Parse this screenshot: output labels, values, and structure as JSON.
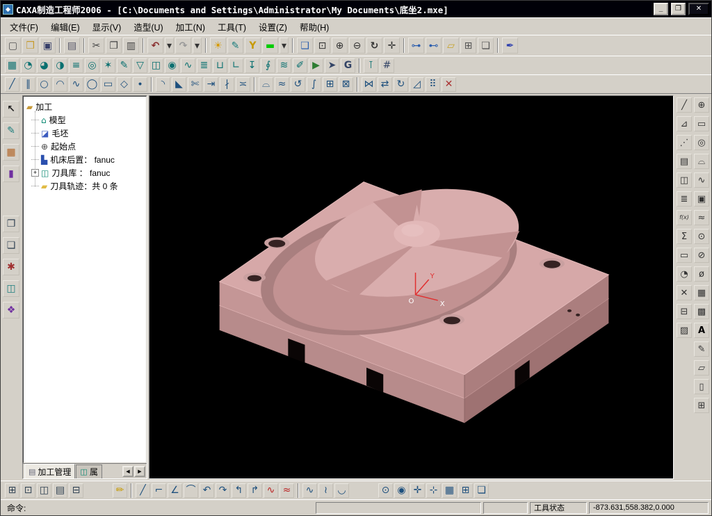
{
  "window": {
    "title": "CAXA制造工程师2006  -  [C:\\Documents and Settings\\Administrator\\My Documents\\底坐2.mxe]",
    "controls": {
      "minimize": "_",
      "restore": "❐",
      "close": "✕"
    }
  },
  "colors": {
    "titlebar": "#000008",
    "canvas-bg": "#000000",
    "model-top": "#d6a8a8",
    "model-side-left": "#c49696",
    "model-side-right": "#ab7e7e",
    "model-base-left": "#b78b8b",
    "model-base-right": "#9e7272",
    "model-rim": "#a97f7f",
    "model-recess": "#c29292",
    "model-boss": "#d9adad",
    "model-boss-light": "#e6bfbf",
    "model-dome": "#e2b8b8",
    "model-hole-rim": "#c9a0a0",
    "model-hole": "#352222",
    "model-notch": "#0a0505",
    "axis-red": "#e03030"
  },
  "menu": {
    "items": [
      {
        "name": "menu-file",
        "label": "文件(F)"
      },
      {
        "name": "menu-edit",
        "label": "编辑(E)"
      },
      {
        "name": "menu-display",
        "label": "显示(V)"
      },
      {
        "name": "menu-modeling",
        "label": "造型(U)"
      },
      {
        "name": "menu-machining",
        "label": "加工(N)"
      },
      {
        "name": "menu-tools",
        "label": "工具(T)"
      },
      {
        "name": "menu-settings",
        "label": "设置(Z)"
      },
      {
        "name": "menu-help",
        "label": "帮助(H)"
      }
    ]
  },
  "toolbar_standard": {
    "items": [
      {
        "name": "new-icon",
        "glyph": "▢",
        "style": "color:#555"
      },
      {
        "name": "open-folder-icon",
        "glyph": "❒",
        "style": "color:#c69b2e"
      },
      {
        "name": "save-icon",
        "glyph": "▣",
        "style": "color:#38406a"
      },
      {
        "cls": "tsep",
        "name": "separator"
      },
      {
        "name": "print-icon",
        "glyph": "▤",
        "style": "color:#556"
      },
      {
        "cls": "tsep",
        "name": "separator"
      },
      {
        "name": "cut-icon",
        "glyph": "✂",
        "style": "color:#444"
      },
      {
        "name": "copy-icon",
        "glyph": "❐",
        "style": "color:#444"
      },
      {
        "name": "paste-icon",
        "glyph": "▥",
        "style": "color:#444"
      },
      {
        "cls": "tsep",
        "name": "separator"
      },
      {
        "name": "undo-icon",
        "glyph": "↶",
        "style": "color:#8a2f2f;font-weight:bold"
      },
      {
        "name": "undo-dropdown-icon",
        "glyph": "▾",
        "cls": "tbtn narrow"
      },
      {
        "name": "redo-icon",
        "glyph": "↷",
        "style": "color:#999;font-weight:bold"
      },
      {
        "name": "redo-dropdown-icon",
        "glyph": "▾",
        "cls": "tbtn narrow"
      },
      {
        "cls": "tsep",
        "name": "separator"
      },
      {
        "name": "light-icon",
        "glyph": "☀",
        "style": "color:#d79a00"
      },
      {
        "name": "shade-mode-icon",
        "glyph": "✎",
        "style": "color:#1b7d7d"
      },
      {
        "name": "filter-icon",
        "glyph": "Y",
        "style": "color:#c79a00;font-weight:bold"
      },
      {
        "name": "color-swatch",
        "glyph": "▬",
        "style": "color:#00cc00"
      },
      {
        "name": "color-dropdown-icon",
        "glyph": "▾",
        "cls": "tbtn narrow"
      },
      {
        "cls": "tsep",
        "name": "separator"
      },
      {
        "name": "viewport-icon",
        "glyph": "❑",
        "style": "color:#2d5fae"
      },
      {
        "name": "zoom-window-icon",
        "glyph": "⊡"
      },
      {
        "name": "zoom-in-icon",
        "glyph": "⊕"
      },
      {
        "name": "zoom-out-icon",
        "glyph": "⊖"
      },
      {
        "name": "refresh-view-icon",
        "glyph": "↻",
        "style": "font-weight:bold"
      },
      {
        "name": "pan-icon",
        "glyph": "✛"
      },
      {
        "cls": "tsep",
        "name": "separator"
      },
      {
        "name": "link-views-icon",
        "glyph": "⊶",
        "style": "color:#2d5fae"
      },
      {
        "name": "unlink-views-icon",
        "glyph": "⊷",
        "style": "color:#2d5fae"
      },
      {
        "name": "measure-icon",
        "glyph": "▱",
        "style": "color:#c7a227"
      },
      {
        "name": "new-window-icon",
        "glyph": "⊞",
        "style": "color:#555"
      },
      {
        "name": "arrange-windows-icon",
        "glyph": "❏",
        "style": "color:#555"
      },
      {
        "cls": "tsep",
        "name": "separator"
      },
      {
        "name": "annotate-icon",
        "glyph": "✒",
        "style": "color:#2d3fae"
      }
    ]
  },
  "toolbar_machining": {
    "items": [
      {
        "name": "stock-define-icon",
        "glyph": "▦"
      },
      {
        "name": "rough-plane-icon",
        "glyph": "◔"
      },
      {
        "name": "rough-region-icon",
        "glyph": "◕"
      },
      {
        "name": "rough-contour-icon",
        "glyph": "◑"
      },
      {
        "name": "finish-parallel-icon",
        "glyph": "≡"
      },
      {
        "name": "finish-contour-icon",
        "glyph": "◎"
      },
      {
        "name": "finish-radial-icon",
        "glyph": "✶"
      },
      {
        "name": "pencil-cut-icon",
        "glyph": "✎"
      },
      {
        "name": "projection-cut-icon",
        "glyph": "▽"
      },
      {
        "name": "region-surface-icon",
        "glyph": "◫"
      },
      {
        "name": "contour-surface-icon",
        "glyph": "◉"
      },
      {
        "name": "guide-curve-icon",
        "glyph": "∿"
      },
      {
        "name": "z-level-icon",
        "glyph": "≣"
      },
      {
        "name": "groove-cut-icon",
        "glyph": "⊔"
      },
      {
        "name": "corner-clean-icon",
        "glyph": "∟"
      },
      {
        "name": "drill-icon",
        "glyph": "↧"
      },
      {
        "name": "thread-cut-icon",
        "glyph": "∮"
      },
      {
        "name": "trajectory-batch-icon",
        "glyph": "≋"
      },
      {
        "name": "trajectory-edit-icon",
        "glyph": "✐"
      },
      {
        "name": "simulate-icon",
        "glyph": "▶",
        "style": "color:#2e7d32"
      },
      {
        "name": "post-process-icon",
        "glyph": "➤",
        "style": "color:#334466"
      },
      {
        "name": "gcode-icon",
        "glyph": "G",
        "style": "color:#334466;font-weight:bold"
      },
      {
        "cls": "tsep",
        "name": "separator"
      },
      {
        "name": "tool-library-icon",
        "glyph": "⊺"
      },
      {
        "name": "machine-setup-icon",
        "glyph": "#",
        "style": "color:#334466"
      }
    ]
  },
  "toolbar_curves": {
    "items": [
      {
        "name": "line-icon",
        "glyph": "╱"
      },
      {
        "name": "parallel-line-icon",
        "glyph": "∥"
      },
      {
        "name": "circle-icon",
        "glyph": "○"
      },
      {
        "name": "arc-icon",
        "glyph": "◠"
      },
      {
        "name": "spline-icon",
        "glyph": "∿"
      },
      {
        "name": "ellipse-icon",
        "glyph": "◯"
      },
      {
        "name": "rectangle-icon",
        "glyph": "▭"
      },
      {
        "name": "polygon-icon",
        "glyph": "◇"
      },
      {
        "name": "point-icon",
        "glyph": "∙"
      },
      {
        "cls": "tsep",
        "name": "separator"
      },
      {
        "name": "fillet-icon",
        "glyph": "◝"
      },
      {
        "name": "chamfer-icon",
        "glyph": "◣"
      },
      {
        "name": "trim-icon",
        "glyph": "✄"
      },
      {
        "name": "extend-icon",
        "glyph": "⇥"
      },
      {
        "name": "break-icon",
        "glyph": "∤"
      },
      {
        "name": "offset-icon",
        "glyph": "≍"
      },
      {
        "cls": "tsep",
        "name": "separator"
      },
      {
        "name": "surface-ruled-icon",
        "glyph": "⌓"
      },
      {
        "name": "surface-loft-icon",
        "glyph": "≈"
      },
      {
        "name": "surface-revolve-icon",
        "glyph": "↺"
      },
      {
        "name": "surface-sweep-icon",
        "glyph": "∫"
      },
      {
        "name": "surface-patch-icon",
        "glyph": "⊞"
      },
      {
        "name": "surface-trim-icon",
        "glyph": "⊠"
      },
      {
        "cls": "tsep",
        "name": "separator"
      },
      {
        "name": "mirror-icon",
        "glyph": "⋈"
      },
      {
        "name": "translate-icon",
        "glyph": "⇄"
      },
      {
        "name": "rotate-icon",
        "glyph": "↻"
      },
      {
        "name": "scale-icon",
        "glyph": "◿"
      },
      {
        "name": "array-icon",
        "glyph": "⠿"
      },
      {
        "name": "delete-icon",
        "glyph": "✕",
        "style": "color:#aa3333"
      }
    ]
  },
  "left_toolbar": {
    "items": [
      {
        "name": "select-cursor-icon",
        "glyph": "↖",
        "style": "font-weight:bold;color:#222"
      },
      {
        "name": "sketch-icon",
        "glyph": "✎",
        "style": "color:#1b7d7d"
      },
      {
        "name": "layer-table-icon",
        "glyph": "▦",
        "style": "color:#b06020"
      },
      {
        "name": "material-icon",
        "glyph": "▮",
        "style": "color:#7030a0"
      },
      {
        "cls": "tgap",
        "name": "gap"
      },
      {
        "name": "copy-feature-icon",
        "glyph": "❐",
        "style": "color:#334455"
      },
      {
        "name": "paste-feature-icon",
        "glyph": "❏",
        "style": "color:#334455"
      },
      {
        "name": "process-sheet-icon",
        "glyph": "✱",
        "style": "color:#a03030"
      },
      {
        "name": "tool-db-icon",
        "glyph": "◫",
        "style": "color:#1b7d7d"
      },
      {
        "name": "palette-icon",
        "glyph": "❖",
        "style": "color:#7030a0"
      }
    ]
  },
  "right_toolbar_outer": {
    "items": [
      {
        "name": "query-line-icon",
        "glyph": "╱"
      },
      {
        "name": "query-angle-icon",
        "glyph": "⊿"
      },
      {
        "name": "query-points-icon",
        "glyph": "⋰"
      },
      {
        "name": "list-data-icon",
        "glyph": "▤"
      },
      {
        "name": "element-props-icon",
        "glyph": "◫"
      },
      {
        "name": "coord-list-icon",
        "glyph": "≣"
      },
      {
        "name": "formula-curve-icon",
        "glyph": "f(x)",
        "style": "font-size:8px;font-style:italic"
      },
      {
        "name": "sum-icon",
        "glyph": "Σ"
      },
      {
        "name": "bounding-box-icon",
        "glyph": "▭"
      },
      {
        "name": "arc-info-icon",
        "glyph": "◔"
      },
      {
        "name": "delete-query-icon",
        "glyph": "✕"
      },
      {
        "name": "collapse-icon",
        "glyph": "⊟"
      },
      {
        "name": "hatch-icon",
        "glyph": "▨"
      }
    ]
  },
  "right_toolbar_inner": {
    "items": [
      {
        "name": "point-tool-icon",
        "glyph": "⊕"
      },
      {
        "name": "rect-tool-icon",
        "glyph": "▭"
      },
      {
        "name": "circle-tool-icon",
        "glyph": "◎"
      },
      {
        "name": "arc-tool-icon",
        "glyph": "⌓"
      },
      {
        "name": "spline-tool-icon",
        "glyph": "∿"
      },
      {
        "name": "solid-box-icon",
        "glyph": "▣"
      },
      {
        "name": "fx-curve-icon",
        "glyph": "≈"
      },
      {
        "name": "circle-center-icon",
        "glyph": "⊙"
      },
      {
        "name": "circle-slash-icon",
        "glyph": "⊘"
      },
      {
        "name": "diameter-icon",
        "glyph": "ø"
      },
      {
        "name": "mesh-icon",
        "glyph": "▦"
      },
      {
        "name": "shade-fill-icon",
        "glyph": "▩"
      },
      {
        "name": "text-tool-icon",
        "glyph": "A",
        "style": "color:#000;font-weight:bold"
      },
      {
        "name": "sketch-pen-icon",
        "glyph": "✎"
      },
      {
        "name": "equal-space-icon",
        "glyph": "▱"
      },
      {
        "name": "frame-icon",
        "glyph": "▯"
      },
      {
        "name": "grid-snap-icon",
        "glyph": "⊞"
      }
    ]
  },
  "bottom_toolbar": {
    "items": [
      {
        "name": "tile-windows-icon",
        "glyph": "⊞",
        "style": "color:#334455"
      },
      {
        "name": "window-zoom-icon",
        "glyph": "⊡",
        "style": "color:#334455"
      },
      {
        "name": "window-split-icon",
        "glyph": "◫",
        "style": "color:#334455"
      },
      {
        "name": "window-list-icon",
        "glyph": "▤",
        "style": "color:#334455"
      },
      {
        "name": "window-close-icon",
        "glyph": "⊟",
        "style": "color:#334455"
      },
      {
        "cls": "tgap",
        "name": "gap"
      },
      {
        "name": "sketch-pencil-icon",
        "glyph": "✏",
        "style": "color:#c79a00"
      },
      {
        "cls": "tsep",
        "name": "separator"
      },
      {
        "name": "line2-icon",
        "glyph": "╱"
      },
      {
        "name": "polyline-icon",
        "glyph": "⌐"
      },
      {
        "name": "angle2-icon",
        "glyph": "∠"
      },
      {
        "name": "arc3-icon",
        "glyph": "⌒"
      },
      {
        "name": "arc-ccw-icon",
        "glyph": "↶"
      },
      {
        "name": "arc-cw-icon",
        "glyph": "↷"
      },
      {
        "name": "curve-s-icon",
        "glyph": "↰"
      },
      {
        "name": "curve-z-icon",
        "glyph": "↱"
      },
      {
        "name": "wave-red-icon",
        "glyph": "∿",
        "style": "color:#bb2222"
      },
      {
        "name": "wave2-red-icon",
        "glyph": "≈",
        "style": "color:#bb2222"
      },
      {
        "cls": "tsep",
        "name": "separator"
      },
      {
        "name": "spline-blue-icon",
        "glyph": "∿"
      },
      {
        "name": "spline-fit-icon",
        "glyph": "≀"
      },
      {
        "name": "arc-low-icon",
        "glyph": "◡"
      },
      {
        "cls": "tgap",
        "name": "gap"
      },
      {
        "name": "snap-center-icon",
        "glyph": "⊙"
      },
      {
        "name": "snap-node-icon",
        "glyph": "◉"
      },
      {
        "name": "snap-cross-icon",
        "glyph": "✛"
      },
      {
        "name": "snap-point-icon",
        "glyph": "⊹"
      },
      {
        "name": "grid-display-icon",
        "glyph": "▦"
      },
      {
        "name": "grid2-icon",
        "glyph": "⊞"
      },
      {
        "name": "layers2-icon",
        "glyph": "❏"
      }
    ]
  },
  "tree": {
    "root": {
      "glyph": "▰",
      "style": "color:#c79a3a",
      "label": "加工"
    },
    "items": [
      {
        "name": "tree-item-model",
        "expander": "",
        "glyph": "⌂",
        "style": "color:#0e8a74",
        "label": "模型"
      },
      {
        "name": "tree-item-blank",
        "expander": "",
        "glyph": "◪",
        "style": "color:#3b5bbf",
        "label": "毛坯"
      },
      {
        "name": "tree-item-start-point",
        "expander": "",
        "glyph": "⊕",
        "style": "color:#444444",
        "label": "起始点"
      },
      {
        "name": "tree-item-post",
        "expander": "",
        "glyph": "▙",
        "style": "color:#2a4fae",
        "label": "机床后置： fanuc"
      },
      {
        "name": "tree-item-tool-library",
        "expander": "+",
        "glyph": "◫",
        "style": "color:#0e8a74",
        "label": "刀具库 ： fanuc"
      },
      {
        "name": "tree-item-toolpaths",
        "expander": "",
        "glyph": "▰",
        "style": "color:#e0bb45",
        "label": "刀具轨迹：共 0 条"
      }
    ]
  },
  "panel_tabs": {
    "tabs": [
      {
        "name": "tab-machining-manager",
        "label": "加工管理",
        "glyph": "▤",
        "style": "color:#667",
        "active": "true"
      },
      {
        "name": "tab-properties",
        "label": "属",
        "glyph": "◫",
        "style": "color:#0e8a74",
        "active": "false"
      }
    ],
    "scroll_left": "◀",
    "scroll_right": "▶"
  },
  "canvas": {
    "axis": {
      "origin_label": "O",
      "x_label": "X",
      "y_label": "Y"
    }
  },
  "status": {
    "command_label": "命令:",
    "tool_state_label": "工具状态",
    "coordinates": "-873.631,558.382,0.000"
  }
}
